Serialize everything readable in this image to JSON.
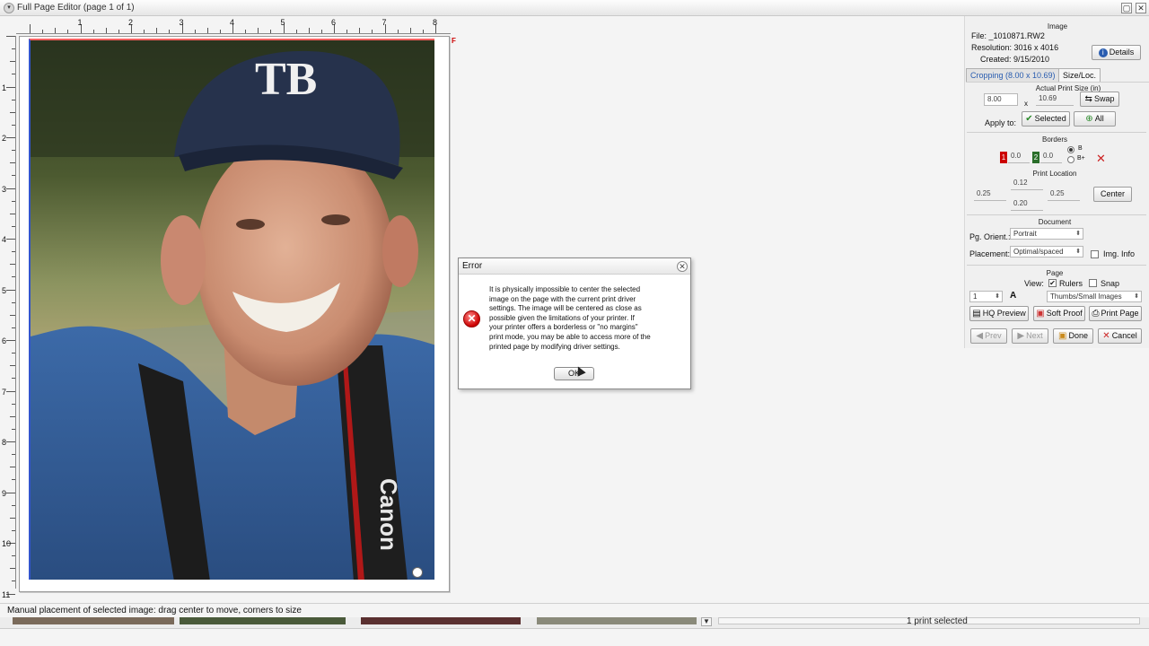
{
  "window": {
    "title": "Full Page Editor (page 1 of 1)",
    "min_glyph": "▢",
    "close_glyph": "✕",
    "menu_glyph": "▾"
  },
  "rulers": {
    "horizontal": [
      "1",
      "2",
      "3",
      "4",
      "5",
      "6",
      "7",
      "8"
    ],
    "vertical": [
      "1",
      "2",
      "3",
      "4",
      "5",
      "6",
      "7",
      "8",
      "9",
      "10",
      "11"
    ]
  },
  "page": {
    "f_marker": "F"
  },
  "image_info": {
    "section_title": "Image",
    "file": "File: _1010871.RW2",
    "resolution": "Resolution: 3016 x 4016",
    "created": "Created: 9/15/2010",
    "details_button": "Details",
    "details_icon_glyph": "i"
  },
  "tabs": [
    {
      "label": "Cropping (8.00 x 10.69)",
      "active": false
    },
    {
      "label": "Size/Loc.",
      "active": true
    }
  ],
  "size_loc": {
    "print_size_title": "Actual Print Size (in)",
    "width_value": "8.00",
    "times": "x",
    "height_value": "10.69",
    "swap_button": "Swap",
    "apply_to_label": "Apply to:",
    "selected_button": "Selected",
    "all_button": "All",
    "borders_title": "Borders",
    "border1_index": "1",
    "border1_value": "0.0",
    "border2_index": "2",
    "border2_value": "0.0",
    "radio_b": "B",
    "radio_bplus": "B+",
    "clear_glyph": "✕",
    "location_title": "Print Location",
    "loc_top": "0.12",
    "loc_left": "0.25",
    "loc_right": "0.25",
    "loc_bottom": "0.20",
    "center_button": "Center"
  },
  "document": {
    "title": "Document",
    "orient_label": "Pg. Orient.:",
    "orient_value": "Portrait",
    "placement_label": "Placement:",
    "placement_value": "Optimal/spaced",
    "img_info_label": "Img. Info"
  },
  "page_controls": {
    "title": "Page",
    "view_label": "View:",
    "rulers_label": "Rulers",
    "snap_label": "Snap",
    "copies_value": "1",
    "font_glyph": "A",
    "thumbs_value": "Thumbs/Small Images",
    "hq_preview": "HQ Preview",
    "soft_proof": "Soft Proof",
    "print_page": "Print Page",
    "prev": "Prev",
    "next": "Next",
    "done": "Done",
    "cancel": "Cancel"
  },
  "dialog": {
    "title": "Error",
    "message": "It is physically impossible to center the selected\nimage on the page with the current print driver\nsettings.  The image will be centered as close as\npossible given the limitations of your printer.  If\nyour printer offers a borderless or \"no margins\"\nprint mode, you may be able to access more of the\nprinted page by modifying driver settings.",
    "ok_button": "OK",
    "close_glyph": "✕",
    "error_glyph": "✕"
  },
  "status": {
    "hint": "Manual placement of selected image: drag center to move, corners to size",
    "prints_selected": "1 print selected"
  },
  "colors": {
    "border1": "#cc0000",
    "border2": "#2a6e2a",
    "accent_link": "#2a5db0"
  }
}
